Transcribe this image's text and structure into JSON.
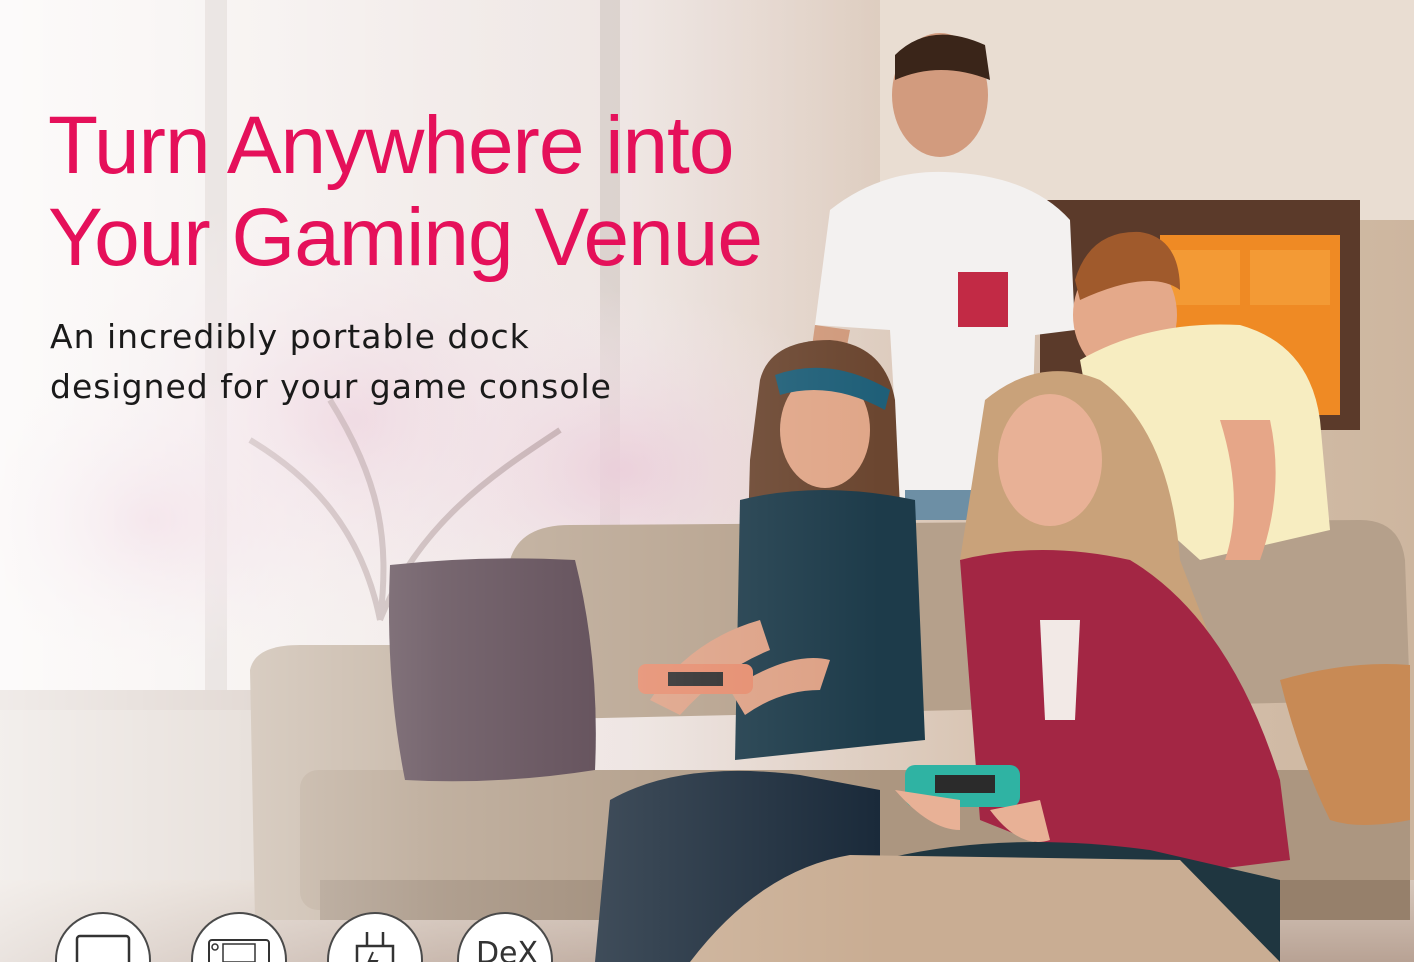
{
  "headline": {
    "line1": "Turn Anywhere into",
    "line2": "Your Gaming Venue"
  },
  "subheadline": {
    "line1": "An incredibly portable dock",
    "line2": "designed for your game console"
  },
  "photo": {
    "subject": "four-friends-playing-video-games-on-sofa"
  },
  "feature_icons": [
    {
      "icon": "monitor-icon"
    },
    {
      "icon": "handheld-console-icon"
    },
    {
      "icon": "power-adapter-icon"
    },
    {
      "icon": "dex-badge-icon",
      "text": "DeX"
    }
  ],
  "colors": {
    "headline": "#e5105a",
    "subheadline": "#1a1a1a"
  }
}
